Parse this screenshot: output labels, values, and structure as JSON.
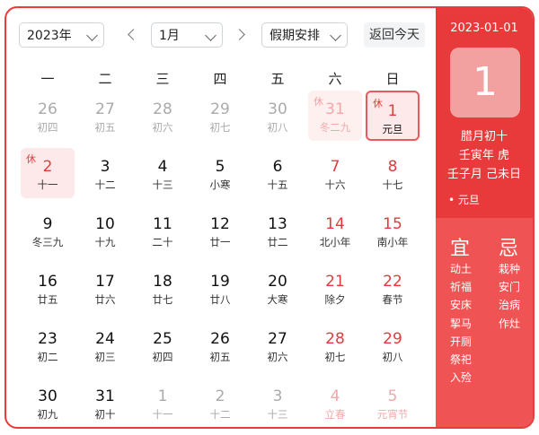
{
  "toolbar": {
    "year": "2023年",
    "month": "1月",
    "holiday": "假期安排",
    "today": "返回今天"
  },
  "weekdays": [
    "一",
    "二",
    "三",
    "四",
    "五",
    "六",
    "日"
  ],
  "days": [
    {
      "d": "26",
      "l": "初四",
      "other": true
    },
    {
      "d": "27",
      "l": "初五",
      "other": true
    },
    {
      "d": "28",
      "l": "初六",
      "other": true
    },
    {
      "d": "29",
      "l": "初七",
      "other": true
    },
    {
      "d": "30",
      "l": "初八",
      "other": true
    },
    {
      "d": "31",
      "l": "冬二九",
      "other": true,
      "wknd": true,
      "hol": true,
      "tag": "休"
    },
    {
      "d": "1",
      "l": "元旦",
      "wknd": true,
      "sel": true,
      "tag": "休"
    },
    {
      "d": "2",
      "l": "十一",
      "wknd": true,
      "hol": true,
      "tag": "休"
    },
    {
      "d": "3",
      "l": "十二"
    },
    {
      "d": "4",
      "l": "十三"
    },
    {
      "d": "5",
      "l": "小寒"
    },
    {
      "d": "6",
      "l": "十五"
    },
    {
      "d": "7",
      "l": "十六",
      "wknd": true
    },
    {
      "d": "8",
      "l": "十七",
      "wknd": true
    },
    {
      "d": "9",
      "l": "冬三九"
    },
    {
      "d": "10",
      "l": "十九"
    },
    {
      "d": "11",
      "l": "二十"
    },
    {
      "d": "12",
      "l": "廿一"
    },
    {
      "d": "13",
      "l": "廿二"
    },
    {
      "d": "14",
      "l": "北小年",
      "wknd": true
    },
    {
      "d": "15",
      "l": "南小年",
      "wknd": true
    },
    {
      "d": "16",
      "l": "廿五"
    },
    {
      "d": "17",
      "l": "廿六"
    },
    {
      "d": "18",
      "l": "廿七"
    },
    {
      "d": "19",
      "l": "廿八"
    },
    {
      "d": "20",
      "l": "大寒"
    },
    {
      "d": "21",
      "l": "除夕",
      "wknd": true
    },
    {
      "d": "22",
      "l": "春节",
      "wknd": true
    },
    {
      "d": "23",
      "l": "初二"
    },
    {
      "d": "24",
      "l": "初三"
    },
    {
      "d": "25",
      "l": "初四"
    },
    {
      "d": "26",
      "l": "初五"
    },
    {
      "d": "27",
      "l": "初六"
    },
    {
      "d": "28",
      "l": "初七",
      "wknd": true
    },
    {
      "d": "29",
      "l": "初八",
      "wknd": true
    },
    {
      "d": "30",
      "l": "初九"
    },
    {
      "d": "31",
      "l": "初十"
    },
    {
      "d": "1",
      "l": "十一",
      "other": true
    },
    {
      "d": "2",
      "l": "十二",
      "other": true
    },
    {
      "d": "3",
      "l": "十三",
      "other": true
    },
    {
      "d": "4",
      "l": "立春",
      "other": true,
      "wknd": true
    },
    {
      "d": "5",
      "l": "元宵节",
      "other": true,
      "wknd": true
    }
  ],
  "panel": {
    "date": "2023-01-01",
    "day": "1",
    "lunar1": "腊月初十",
    "lunar2": "壬寅年 虎",
    "lunar3": "壬子月 己未日",
    "festival": "• 元旦",
    "yi_label": "宜",
    "ji_label": "忌",
    "yi": [
      "动土",
      "祈福",
      "安床",
      "挈马",
      "开厕",
      "祭祀",
      "入殓"
    ],
    "ji": [
      "栽种",
      "安门",
      "治病",
      "作灶"
    ]
  }
}
